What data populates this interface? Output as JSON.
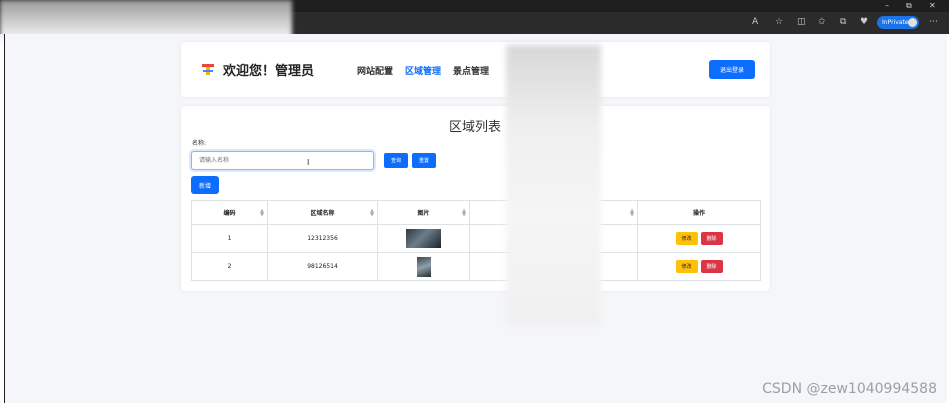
{
  "browser": {
    "inprivate_label": "InPrivate",
    "window_controls": {
      "minimize": "–",
      "restore": "⧉",
      "close": "✕"
    }
  },
  "header": {
    "welcome": "欢迎您！管理员",
    "nav": [
      "网站配置",
      "区域管理",
      "景点管理"
    ],
    "active_nav": "区域管理",
    "logout_label": "退出登录"
  },
  "list": {
    "title": "区域列表",
    "name_label": "名称:",
    "name_placeholder": "请输入名称",
    "search_label": "查询",
    "reset_label": "重置",
    "add_label": "新增",
    "columns": [
      "编码",
      "区域名称",
      "图片",
      "",
      "操作"
    ],
    "rows": [
      {
        "code": "1",
        "name": "12312356"
      },
      {
        "code": "2",
        "name": "98126514"
      }
    ],
    "edit_label": "修改",
    "delete_label": "删除"
  },
  "watermark": "CSDN @zew1040994588",
  "colors": {
    "primary": "#0d6efd",
    "warning": "#ffc107",
    "danger": "#dc3545"
  }
}
